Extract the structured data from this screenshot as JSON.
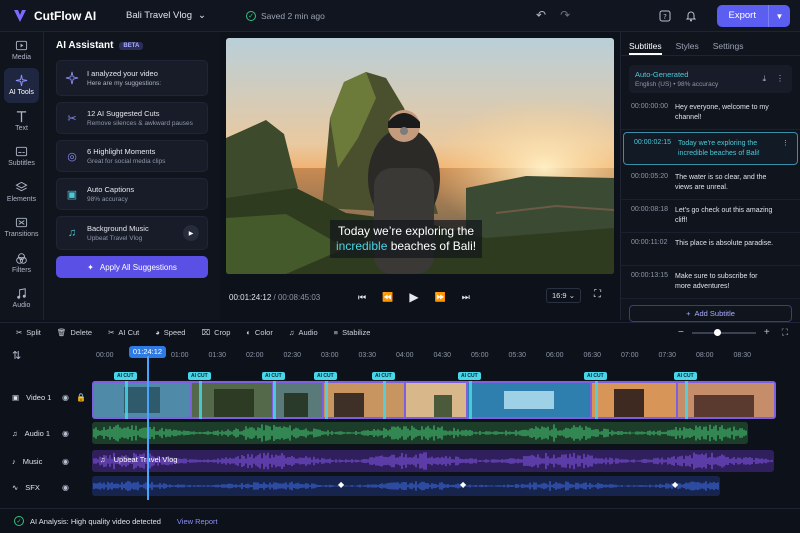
{
  "app": {
    "name": "CutFlow AI",
    "project": "Bali Travel Vlog",
    "saved": "Saved 2 min ago",
    "export_label": "Export"
  },
  "rail": [
    {
      "label": "Media",
      "icon": "media-icon"
    },
    {
      "label": "AI Tools",
      "icon": "ai-tools-icon"
    },
    {
      "label": "Text",
      "icon": "text-icon"
    },
    {
      "label": "Subtitles",
      "icon": "subtitles-icon"
    },
    {
      "label": "Elements",
      "icon": "elements-icon"
    },
    {
      "label": "Transitions",
      "icon": "transitions-icon"
    },
    {
      "label": "Filters",
      "icon": "filters-icon"
    },
    {
      "label": "Audio",
      "icon": "audio-icon"
    }
  ],
  "assistant": {
    "title": "AI Assistant",
    "badge": "BETA",
    "intro": {
      "line1": "I analyzed your video",
      "line2": "Here are my suggestions:"
    },
    "cards": [
      {
        "title": "12 AI Suggested Cuts",
        "sub": "Remove silences & awkward pauses"
      },
      {
        "title": "6 Highlight Moments",
        "sub": "Great for social media clips"
      },
      {
        "title": "Auto Captions",
        "sub": "98% accuracy"
      },
      {
        "title": "Background Music",
        "sub": "Upbeat Travel Vlog"
      }
    ],
    "apply_label": "Apply All Suggestions"
  },
  "preview": {
    "caption_pre": "Today we’re exploring the",
    "caption_hl": "incredible",
    "caption_post": " beaches of Bali!",
    "current_time": "00:01:24:12",
    "separator": "/",
    "duration": "00:08:45:03",
    "aspect": "16:9"
  },
  "subtitles": {
    "tabs": [
      "Subtitles",
      "Styles",
      "Settings"
    ],
    "auto_title": "Auto-Generated",
    "auto_sub": "English (US)  •  98% accuracy",
    "rows": [
      {
        "time": "00:00:00:00",
        "text": "Hey everyone, welcome to my channel!"
      },
      {
        "time": "00:00:02:15",
        "text": "Today we're exploring the incredible beaches of Bali!"
      },
      {
        "time": "00:00:05:20",
        "text": "The water is so clear, and the views are unreal."
      },
      {
        "time": "00:00:08:18",
        "text": "Let's go check out this amazing cliff!"
      },
      {
        "time": "00:00:11:02",
        "text": "This place is absolute paradise."
      },
      {
        "time": "00:00:13:15",
        "text": "Make sure to subscribe for more adventures!"
      }
    ],
    "add_label": "Add Subtitle"
  },
  "toolbar": [
    "Split",
    "Delete",
    "AI Cut",
    "Speed",
    "Crop",
    "Color",
    "Audio",
    "Stabilize"
  ],
  "timeline": {
    "playhead": "01:24:12",
    "ticks": [
      "00:00",
      "00:30",
      "01:00",
      "01:30",
      "02:00",
      "02:30",
      "03:00",
      "03:30",
      "04:00",
      "04:30",
      "05:00",
      "05:30",
      "06:00",
      "06:30",
      "07:00",
      "07:30",
      "08:00",
      "08:30"
    ],
    "tracks": [
      "Video 1",
      "Audio 1",
      "Music",
      "SFX"
    ],
    "music_clip": "Upbeat Travel Vlog",
    "ai_cut_label": "AI CUT"
  },
  "status": {
    "text": "AI Analysis: High quality video detected",
    "link": "View Report"
  },
  "colors": {
    "accent": "#5b5ef0",
    "cyan": "#48d6e8",
    "audio": "#2e8c55",
    "music": "#5d3aa8",
    "sfx": "#2b3f8f"
  }
}
